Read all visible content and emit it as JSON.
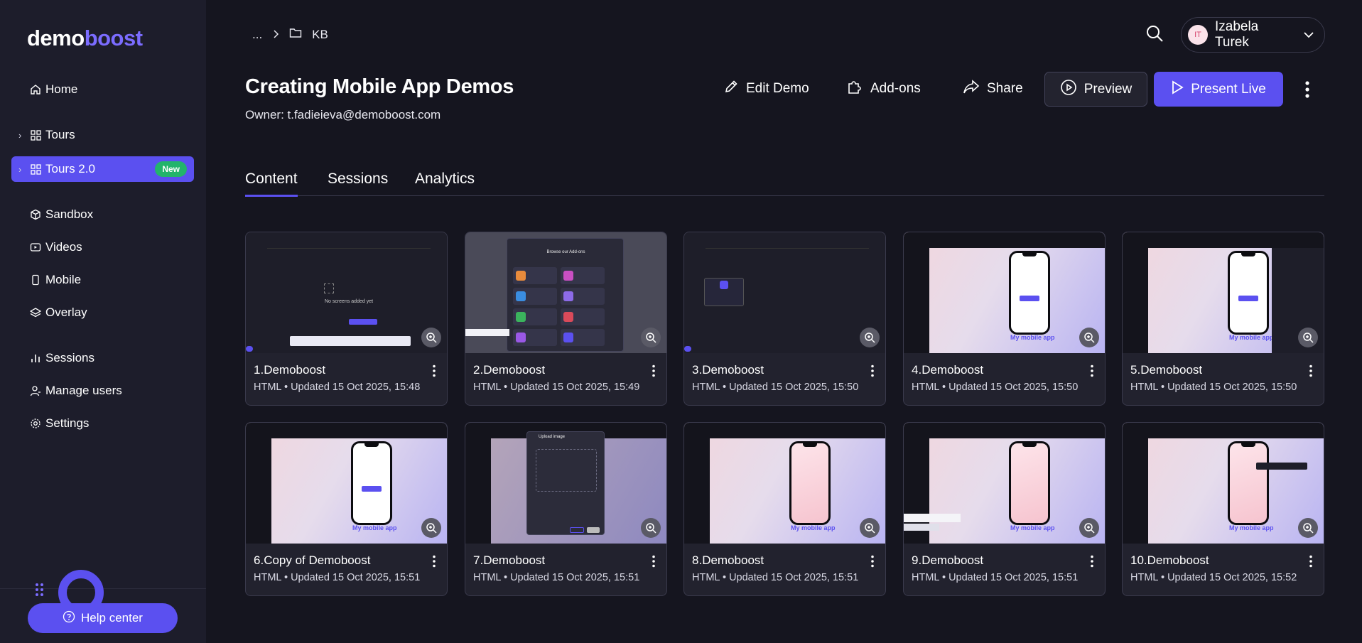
{
  "brand": {
    "logo_part1": "demo",
    "logo_part2": "boost"
  },
  "sidebar": {
    "items": [
      {
        "label": "Home",
        "icon": "home-icon"
      },
      {
        "label": "Tours",
        "icon": "grid-icon"
      },
      {
        "label": "Tours 2.0",
        "icon": "grid-icon",
        "badge": "New"
      },
      {
        "label": "Sandbox",
        "icon": "cube-icon"
      },
      {
        "label": "Videos",
        "icon": "video-icon"
      },
      {
        "label": "Mobile",
        "icon": "mobile-icon"
      },
      {
        "label": "Overlay",
        "icon": "layers-icon"
      },
      {
        "label": "Sessions",
        "icon": "bar-chart-icon"
      },
      {
        "label": "Manage users",
        "icon": "user-icon"
      },
      {
        "label": "Settings",
        "icon": "gear-icon"
      }
    ],
    "help_label": "Help center"
  },
  "breadcrumb": {
    "ellipsis": "...",
    "folder": "KB"
  },
  "user": {
    "initials": "IT",
    "name": "Izabela Turek"
  },
  "page": {
    "title": "Creating Mobile App Demos",
    "owner": "Owner: t.fadieieva@demoboost.com"
  },
  "actions": {
    "edit": "Edit Demo",
    "addons": "Add-ons",
    "share": "Share",
    "preview": "Preview",
    "present": "Present Live"
  },
  "tabs": [
    "Content",
    "Sessions",
    "Analytics"
  ],
  "cards": [
    {
      "index": "1.",
      "title": "Demoboost",
      "meta": "HTML • Updated 15 Oct 2025, 15:48"
    },
    {
      "index": "2.",
      "title": "Demoboost",
      "meta": "HTML • Updated 15 Oct 2025, 15:49"
    },
    {
      "index": "3.",
      "title": "Demoboost",
      "meta": "HTML • Updated 15 Oct 2025, 15:50"
    },
    {
      "index": "4.",
      "title": "Demoboost",
      "meta": "HTML • Updated 15 Oct 2025, 15:50"
    },
    {
      "index": "5.",
      "title": "Demoboost",
      "meta": "HTML • Updated 15 Oct 2025, 15:50"
    },
    {
      "index": "6.",
      "title": "Copy of Demoboost",
      "meta": "HTML • Updated 15 Oct 2025, 15:51"
    },
    {
      "index": "7.",
      "title": "Demoboost",
      "meta": "HTML • Updated 15 Oct 2025, 15:51"
    },
    {
      "index": "8.",
      "title": "Demoboost",
      "meta": "HTML • Updated 15 Oct 2025, 15:51"
    },
    {
      "index": "9.",
      "title": "Demoboost",
      "meta": "HTML • Updated 15 Oct 2025, 15:51"
    },
    {
      "index": "10.",
      "title": "Demoboost",
      "meta": "HTML • Updated 15 Oct 2025, 15:52"
    }
  ],
  "thumb_text": {
    "mobile_app": "My mobile app",
    "no_screens": "No screens added yet",
    "add_ons_title": "Browse our Add-ons",
    "upload_image": "Upload image"
  },
  "colors": {
    "accent": "#5b50f0",
    "sidebar_bg": "#1d1d2b",
    "page_bg": "#15151f",
    "badge_green": "#22b46b"
  }
}
